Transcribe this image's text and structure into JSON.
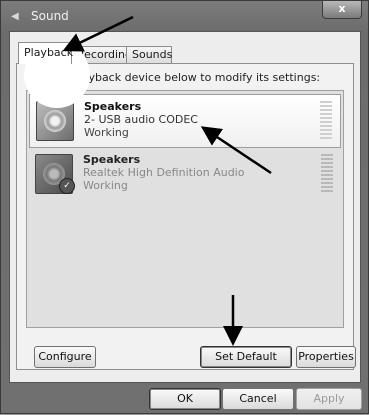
{
  "window": {
    "title": "Sound",
    "close_label": "x"
  },
  "tabs": [
    {
      "label": "Playback",
      "active": true
    },
    {
      "label": "Recording",
      "active": false
    },
    {
      "label": "Sounds",
      "active": false
    }
  ],
  "instruction": "Select a playback device below to modify its settings:",
  "devices": [
    {
      "name": "Speakers",
      "description": "2- USB audio CODEC",
      "status": "Working",
      "selected": true,
      "default": false
    },
    {
      "name": "Speakers",
      "description": "Realtek High Definition Audio",
      "status": "Working",
      "selected": false,
      "default": true
    }
  ],
  "buttons": {
    "configure": "Configure",
    "set_default": "Set Default",
    "properties": "Properties",
    "ok": "OK",
    "cancel": "Cancel",
    "apply": "Apply"
  },
  "icons": {
    "title": "speaker-icon",
    "device": "speaker-icon",
    "default_badge": "check-icon"
  }
}
